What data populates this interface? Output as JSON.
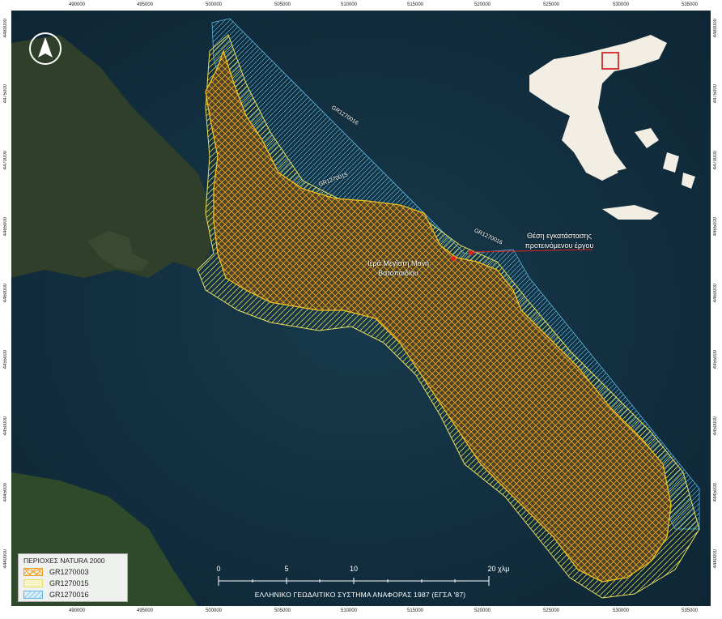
{
  "axes": {
    "x_ticks": [
      "490000",
      "495000",
      "500000",
      "505000",
      "510000",
      "515000",
      "520000",
      "525000",
      "530000",
      "535000"
    ],
    "y_ticks": [
      "4480000",
      "4475000",
      "4470000",
      "4465000",
      "4460000",
      "4455000",
      "4450000",
      "4445000",
      "4440000"
    ]
  },
  "legend": {
    "title": "ΠΕΡΙΟΧΕΣ NATURA 2000",
    "items": [
      {
        "label": "GR1270003",
        "color": "#f0a020"
      },
      {
        "label": "GR1270015",
        "color": "#e8e060"
      },
      {
        "label": "GR1270016",
        "color": "#5ab4e0"
      }
    ]
  },
  "scalebar": {
    "ticks": [
      "0",
      "5",
      "10",
      "20 χλμ"
    ]
  },
  "datum": "ΕΛΛΗΝΙΚΟ ΓΕΩΔΑΙΤΙΚΟ ΣΥΣΤΗΜΑ ΑΝΑΦΟΡΑΣ 1987 (ΕΓΣΑ '87)",
  "labels": {
    "monastery": [
      "Ιερά Μεγίστη Μονή",
      "Βατοπαιδίου"
    ],
    "project_site": [
      "Θέση εγκατάστασης",
      "προτεινόμενου έργου"
    ],
    "site_ref_1": "GR1270016",
    "site_ref_2": "GR1270015",
    "site_ref_3": "GR1270016"
  },
  "colors": {
    "sea": "#12303f",
    "land": "#3a4a2a",
    "orange": "#f0a020",
    "yellow": "#e8e060",
    "blue": "#5ab4e0",
    "marker": "#e02020"
  }
}
